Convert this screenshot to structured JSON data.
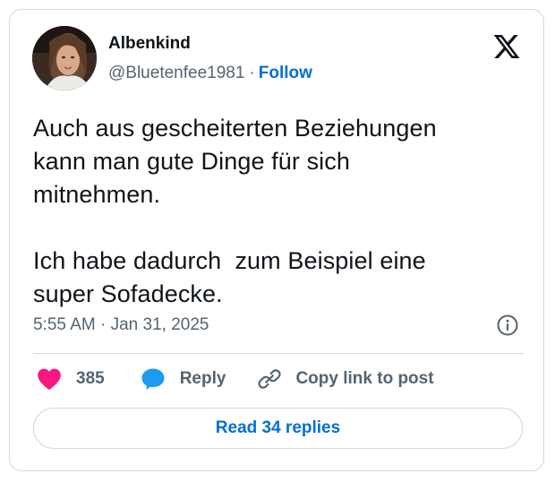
{
  "author": {
    "display_name": "Albenkind",
    "handle": "@Bluetenfee1981",
    "separator": "·",
    "follow_label": "Follow"
  },
  "tweet": {
    "paragraphs": [
      "Auch aus gescheiterten Beziehungen\nkann man gute Dinge für sich\nmitnehmen.",
      "Ich habe dadurch  zum Beispiel eine\nsuper Sofadecke."
    ],
    "timestamp": "5:55 AM · Jan 31, 2025"
  },
  "actions": {
    "like_count": "385",
    "reply_label": "Reply",
    "copy_link_label": "Copy link to post"
  },
  "read_replies_label": "Read 34 replies",
  "icons": {
    "brand": "x-logo-icon",
    "info": "info-icon",
    "like": "heart-icon",
    "reply": "reply-bubble-icon",
    "copy": "link-icon"
  },
  "colors": {
    "like": "#f91880",
    "reply": "#1d9bf0",
    "link": "#006fd6",
    "muted": "#536471",
    "border": "#cfd9de"
  }
}
